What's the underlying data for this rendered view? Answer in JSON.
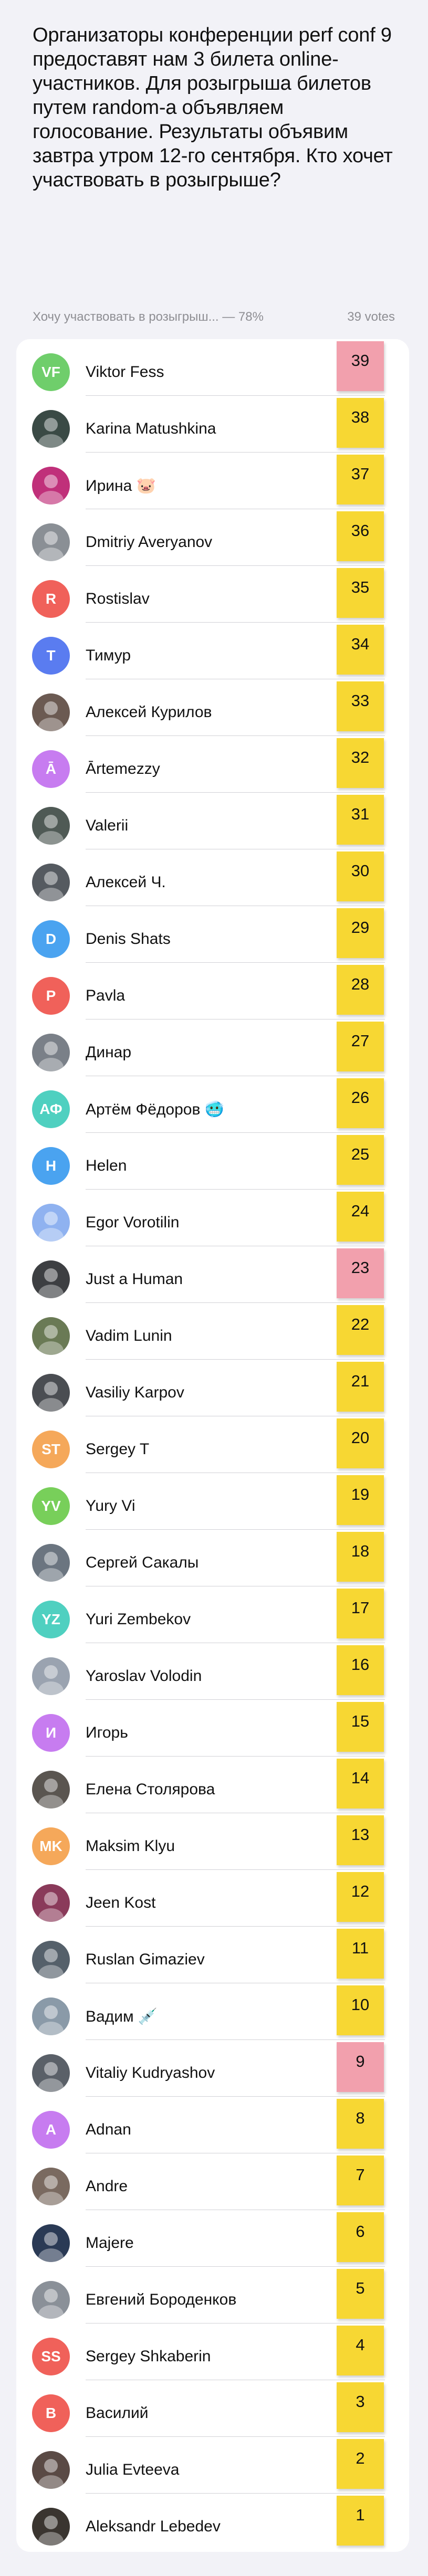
{
  "poll": {
    "question": "Организаторы конференции perf conf 9 предоставят нам 3 билета online-участников. Для розыгрыша билетов путем random-а объявляем голосование. Результаты объявим завтра утром 12-го сентября. Кто хочет участвовать в розыгрыше?",
    "option_summary": "Хочу участвовать в розыгрыш... — 78%",
    "votes_label": "39 votes"
  },
  "colors": {
    "sticky_yellow": "#f7d733",
    "sticky_pink": "#f2a0ad",
    "background": "#f2f2f7"
  },
  "voters": [
    {
      "name": "Viktor Fess",
      "number": "39",
      "avatar": "VF",
      "avatar_color": "#6fce6b",
      "sticky": "pink"
    },
    {
      "name": "Karina Matushkina",
      "number": "38",
      "avatar": "",
      "avatar_color": "#3a4a45",
      "sticky": "yellow"
    },
    {
      "name": "Ирина 🐷",
      "number": "37",
      "avatar": "",
      "avatar_color": "#c0307a",
      "sticky": "yellow"
    },
    {
      "name": "Dmitriy Averyanov",
      "number": "36",
      "avatar": "",
      "avatar_color": "#8a8f95",
      "sticky": "yellow"
    },
    {
      "name": "Rostislav",
      "number": "35",
      "avatar": "R",
      "avatar_color": "#f0615a",
      "sticky": "yellow"
    },
    {
      "name": "Тимур",
      "number": "34",
      "avatar": "T",
      "avatar_color": "#5a7cf0",
      "sticky": "yellow"
    },
    {
      "name": "Алексей Курилов",
      "number": "33",
      "avatar": "",
      "avatar_color": "#6b5a52",
      "sticky": "yellow"
    },
    {
      "name": "Ārtemezzy",
      "number": "32",
      "avatar": "Ā",
      "avatar_color": "#c77cf0",
      "sticky": "yellow"
    },
    {
      "name": "Valerii",
      "number": "31",
      "avatar": "",
      "avatar_color": "#4f5a55",
      "sticky": "yellow"
    },
    {
      "name": "Алексей Ч.",
      "number": "30",
      "avatar": "",
      "avatar_color": "#555a60",
      "sticky": "yellow"
    },
    {
      "name": "Denis Shats",
      "number": "29",
      "avatar": "D",
      "avatar_color": "#4aa3f0",
      "sticky": "yellow"
    },
    {
      "name": "Pavla",
      "number": "28",
      "avatar": "P",
      "avatar_color": "#f0615a",
      "sticky": "yellow"
    },
    {
      "name": "Динар",
      "number": "27",
      "avatar": "",
      "avatar_color": "#7a8088",
      "sticky": "yellow"
    },
    {
      "name": "Артём Фёдоров 🥶",
      "number": "26",
      "avatar": "АФ",
      "avatar_color": "#4fd0c0",
      "sticky": "yellow"
    },
    {
      "name": "Helen",
      "number": "25",
      "avatar": "H",
      "avatar_color": "#4aa3f0",
      "sticky": "yellow"
    },
    {
      "name": "Egor Vorotilin",
      "number": "24",
      "avatar": "",
      "avatar_color": "#8fb2f0",
      "sticky": "yellow"
    },
    {
      "name": "Just a Human",
      "number": "23",
      "avatar": "",
      "avatar_color": "#3d3f42",
      "sticky": "pink"
    },
    {
      "name": "Vadim Lunin",
      "number": "22",
      "avatar": "",
      "avatar_color": "#6a7a55",
      "sticky": "yellow"
    },
    {
      "name": "Vasiliy Karpov",
      "number": "21",
      "avatar": "",
      "avatar_color": "#4a4d52",
      "sticky": "yellow"
    },
    {
      "name": "Sergey T",
      "number": "20",
      "avatar": "ST",
      "avatar_color": "#f5a85a",
      "sticky": "yellow"
    },
    {
      "name": "Yury Vi",
      "number": "19",
      "avatar": "YV",
      "avatar_color": "#78cf5a",
      "sticky": "yellow"
    },
    {
      "name": "Сергей Сакалы",
      "number": "18",
      "avatar": "",
      "avatar_color": "#6b7580",
      "sticky": "yellow"
    },
    {
      "name": "Yuri Zembekov",
      "number": "17",
      "avatar": "YZ",
      "avatar_color": "#4fd0c0",
      "sticky": "yellow"
    },
    {
      "name": "Yaroslav Volodin",
      "number": "16",
      "avatar": "",
      "avatar_color": "#9aa3b0",
      "sticky": "yellow"
    },
    {
      "name": "Игорь",
      "number": "15",
      "avatar": "И",
      "avatar_color": "#c77cf0",
      "sticky": "yellow"
    },
    {
      "name": "Елена Столярова",
      "number": "14",
      "avatar": "",
      "avatar_color": "#5a5550",
      "sticky": "yellow"
    },
    {
      "name": "Maksim Klyu",
      "number": "13",
      "avatar": "MK",
      "avatar_color": "#f5a85a",
      "sticky": "yellow"
    },
    {
      "name": "Jeen Kost",
      "number": "12",
      "avatar": "",
      "avatar_color": "#8a3a5a",
      "sticky": "yellow"
    },
    {
      "name": "Ruslan Gimaziev",
      "number": "11",
      "avatar": "",
      "avatar_color": "#55606a",
      "sticky": "yellow"
    },
    {
      "name": "Вадим 💉",
      "number": "10",
      "avatar": "",
      "avatar_color": "#8a9aa8",
      "sticky": "yellow"
    },
    {
      "name": "Vitaliy Kudryashov",
      "number": "9",
      "avatar": "",
      "avatar_color": "#5a6068",
      "sticky": "pink"
    },
    {
      "name": "Adnan",
      "number": "8",
      "avatar": "A",
      "avatar_color": "#c77cf0",
      "sticky": "yellow"
    },
    {
      "name": "Andre",
      "number": "7",
      "avatar": "",
      "avatar_color": "#7a6a60",
      "sticky": "yellow"
    },
    {
      "name": "Majere",
      "number": "6",
      "avatar": "",
      "avatar_color": "#2a3a55",
      "sticky": "yellow"
    },
    {
      "name": "Евгений Бороденков",
      "number": "5",
      "avatar": "",
      "avatar_color": "#8a9098",
      "sticky": "yellow"
    },
    {
      "name": "Sergey Shkaberin",
      "number": "4",
      "avatar": "SS",
      "avatar_color": "#f0615a",
      "sticky": "yellow"
    },
    {
      "name": "Василий",
      "number": "3",
      "avatar": "В",
      "avatar_color": "#f0615a",
      "sticky": "yellow"
    },
    {
      "name": "Julia Evteeva",
      "number": "2",
      "avatar": "",
      "avatar_color": "#5a4a45",
      "sticky": "yellow"
    },
    {
      "name": "Aleksandr Lebedev",
      "number": "1",
      "avatar": "",
      "avatar_color": "#3a3530",
      "sticky": "yellow"
    }
  ]
}
